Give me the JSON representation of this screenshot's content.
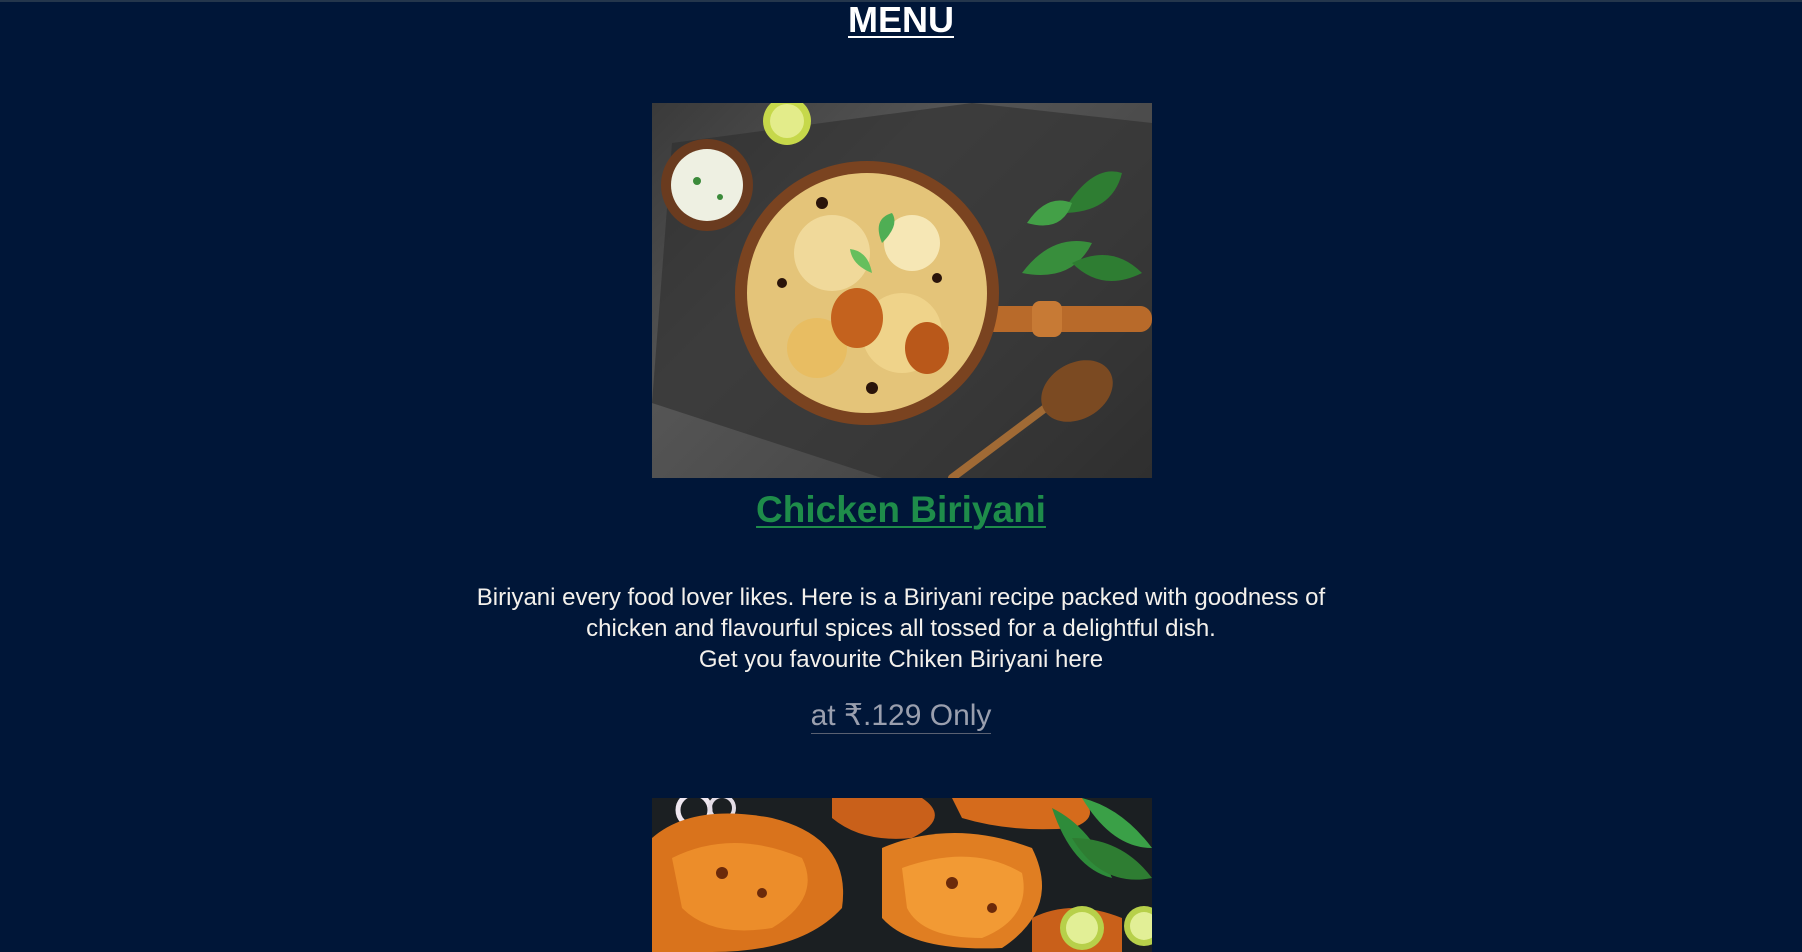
{
  "page": {
    "title": "MENU"
  },
  "colors": {
    "background": "#001638",
    "title": "#ffffff",
    "dish_name": "#1e8c4a",
    "description": "#f4f1ec",
    "price": "#9a9fae"
  },
  "menu": {
    "items": [
      {
        "name": "Chicken Biriyani",
        "description_lines": [
          "Biriyani every food lover likes. Here is a Biriyani recipe packed with goodness of",
          "chicken and flavourful spices all tossed for a delightful dish.",
          "Get you favourite Chiken Biriyani here"
        ],
        "price": "at ₹.129 Only"
      }
    ]
  }
}
